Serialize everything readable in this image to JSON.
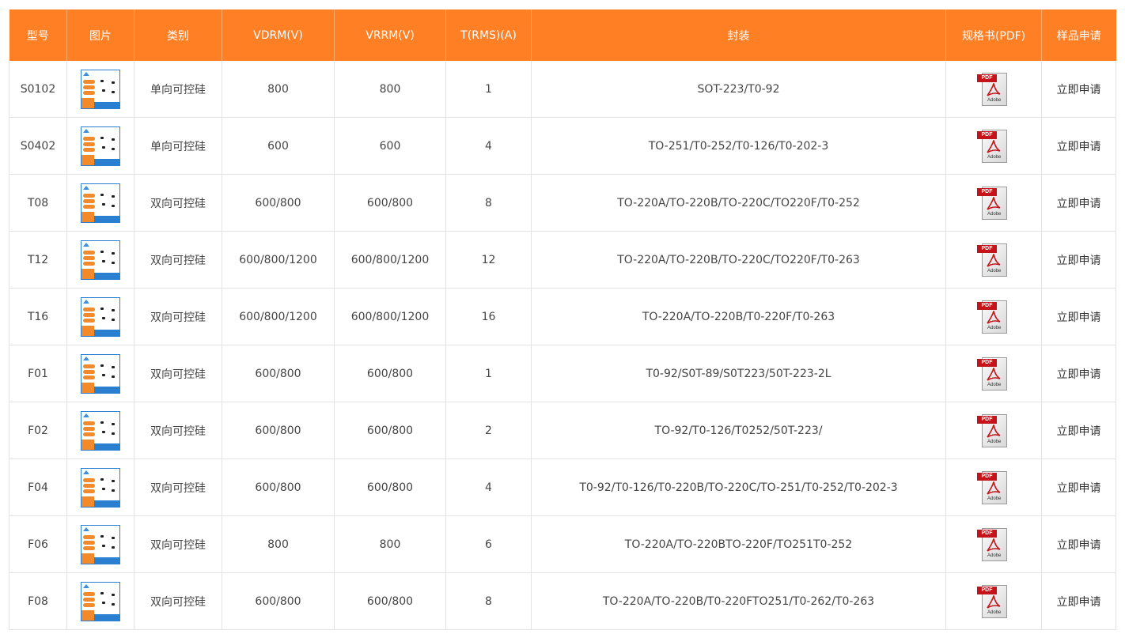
{
  "columns": [
    "型号",
    "图片",
    "类别",
    "VDRM(V)",
    "VRRM(V)",
    "T(RMS)(A)",
    "封装",
    "规格书(PDF)",
    "样品申请"
  ],
  "pdf_label": "PDF",
  "adobe_label": "Adobe",
  "colors": {
    "header": "#fe7f24",
    "border": "#e3e3e3",
    "pdf_red": "#c3141b"
  },
  "rows": [
    {
      "model": "S0102",
      "category": "单向可控硅",
      "vdrm": "800",
      "vrrm": "800",
      "trms": "1",
      "package": "SOT-223/T0-92",
      "apply": "立即申请"
    },
    {
      "model": "S0402",
      "category": "单向可控硅",
      "vdrm": "600",
      "vrrm": "600",
      "trms": "4",
      "package": "TO-251/T0-252/T0-126/T0-202-3",
      "apply": "立即申请"
    },
    {
      "model": "T08",
      "category": "双向可控硅",
      "vdrm": "600/800",
      "vrrm": "600/800",
      "trms": "8",
      "package": "TO-220A/TO-220B/TO-220C/TO220F/T0-252",
      "apply": "立即申请"
    },
    {
      "model": "T12",
      "category": "双向可控硅",
      "vdrm": "600/800/1200",
      "vrrm": "600/800/1200",
      "trms": "12",
      "package": "TO-220A/TO-220B/TO-220C/TO220F/T0-263",
      "apply": "立即申请"
    },
    {
      "model": "T16",
      "category": "双向可控硅",
      "vdrm": "600/800/1200",
      "vrrm": "600/800/1200",
      "trms": "16",
      "package": "TO-220A/TO-220B/T0-220F/T0-263",
      "apply": "立即申请"
    },
    {
      "model": "F01",
      "category": "双向可控硅",
      "vdrm": "600/800",
      "vrrm": "600/800",
      "trms": "1",
      "package": "T0-92/S0T-89/S0T223/50T-223-2L",
      "apply": "立即申请"
    },
    {
      "model": "F02",
      "category": "双向可控硅",
      "vdrm": "600/800",
      "vrrm": "600/800",
      "trms": "2",
      "package": "TO-92/T0-126/T0252/50T-223/",
      "apply": "立即申请"
    },
    {
      "model": "F04",
      "category": "双向可控硅",
      "vdrm": "600/800",
      "vrrm": "600/800",
      "trms": "4",
      "package": "T0-92/T0-126/T0-220B/TO-220C/TO-251/T0-252/T0-202-3",
      "apply": "立即申请"
    },
    {
      "model": "F06",
      "category": "双向可控硅",
      "vdrm": "800",
      "vrrm": "800",
      "trms": "6",
      "package": "TO-220A/TO-220BTO-220F/TO251T0-252",
      "apply": "立即申请"
    },
    {
      "model": "F08",
      "category": "双向可控硅",
      "vdrm": "600/800",
      "vrrm": "600/800",
      "trms": "8",
      "package": "TO-220A/TO-220B/T0-220FTO251/T0-262/T0-263",
      "apply": "立即申请"
    }
  ]
}
